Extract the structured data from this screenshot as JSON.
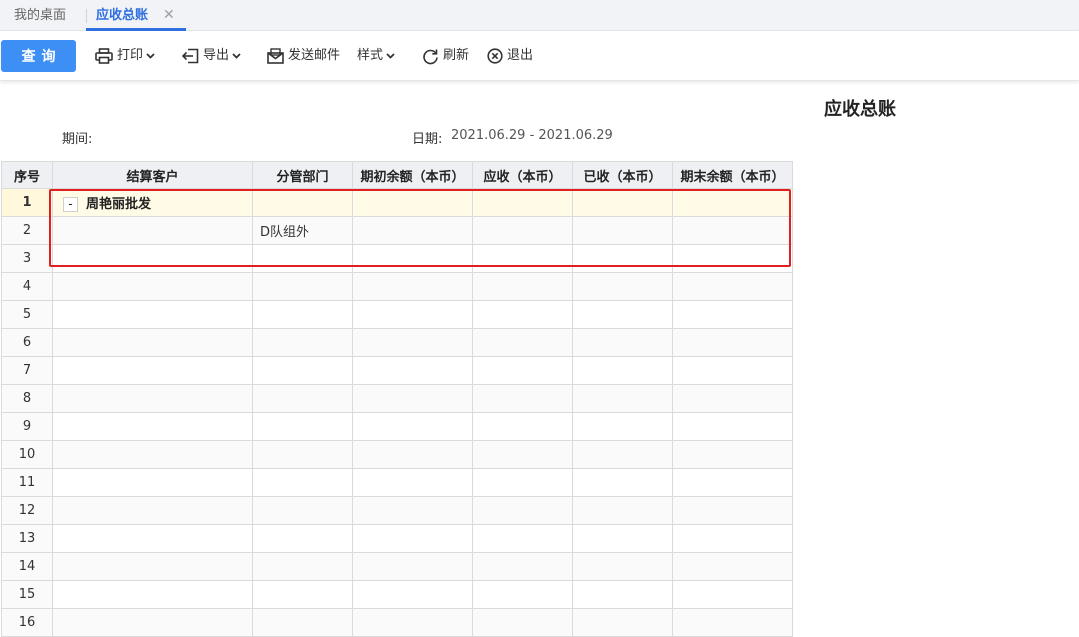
{
  "tabs": {
    "home_label": "我的桌面",
    "active_label": "应收总账",
    "close_glyph": "✕"
  },
  "toolbar": {
    "query_label": "查询",
    "print_label": "打印",
    "export_label": "导出",
    "email_label": "发送邮件",
    "style_label": "样式",
    "refresh_label": "刷新",
    "exit_label": "退出"
  },
  "report": {
    "title": "应收总账",
    "period_label": "期间:",
    "date_label": "日期:",
    "date_value": "2021.06.29 - 2021.06.29"
  },
  "table": {
    "headers": [
      "序号",
      "结算客户",
      "分管部门",
      "期初余额（本币）",
      "应收（本币）",
      "已收（本币）",
      "期末余额（本币）"
    ],
    "rows": [
      {
        "seq": "1",
        "customer": "周艳丽批发",
        "dept": "",
        "expand": "-"
      },
      {
        "seq": "2",
        "customer": "",
        "dept": "D队组外"
      },
      {
        "seq": "3"
      },
      {
        "seq": "4"
      },
      {
        "seq": "5"
      },
      {
        "seq": "6"
      },
      {
        "seq": "7"
      },
      {
        "seq": "8"
      },
      {
        "seq": "9"
      },
      {
        "seq": "10"
      },
      {
        "seq": "11"
      },
      {
        "seq": "12"
      },
      {
        "seq": "13"
      },
      {
        "seq": "14"
      },
      {
        "seq": "15"
      },
      {
        "seq": "16"
      }
    ]
  },
  "colors": {
    "accent": "#3d8ef5",
    "tab_active": "#2f6fe0",
    "highlight": "#e02020"
  }
}
